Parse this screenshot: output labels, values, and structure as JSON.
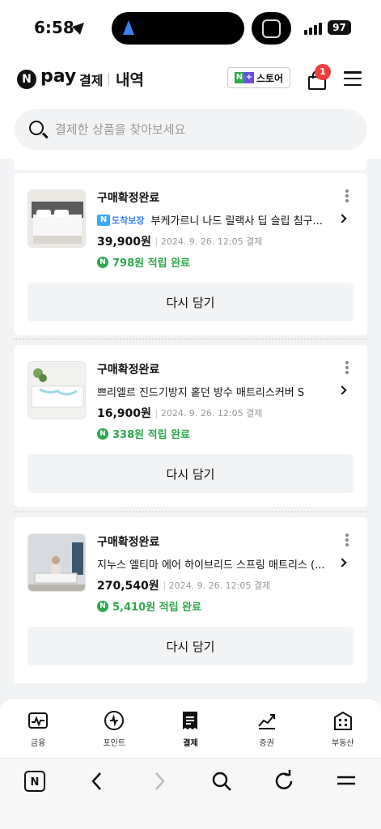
{
  "status_bar": {
    "time": "6:58",
    "battery": "97"
  },
  "header": {
    "logo_n": "N",
    "logo_pay": "pay",
    "logo_sub": "결제",
    "title": "내역",
    "store_label": "스토어",
    "store_badge_n": "N",
    "store_badge_plus": "+",
    "cart_count": "1"
  },
  "search": {
    "placeholder": "결제한 상품을 찾아보세요"
  },
  "orders": [
    {
      "status": "구매확정완료",
      "badge": "도착보장",
      "badge_n": "N",
      "name": "부케가르니 나드 릴랙사 딥 슬립 침구...",
      "price": "39,900원",
      "date": "2024. 9. 26. 12:05 결제",
      "reward": "798원 적립 완료",
      "reward_icon": "N",
      "button": "다시 담기"
    },
    {
      "status": "구매확정완료",
      "name": "쁘리엘르 진드기방지 홑던 방수 매트리스커버 S",
      "price": "16,900원",
      "date": "2024. 9. 26. 12:05 결제",
      "reward": "338원 적립 완료",
      "reward_icon": "N",
      "button": "다시 담기"
    },
    {
      "status": "구매확정완료",
      "name": "지누스 엘티마 에어 하이브리드 스프링 매트리스 (...",
      "price": "270,540원",
      "date": "2024. 9. 26. 12:05 결제",
      "reward": "5,410원 적립 완료",
      "reward_icon": "N",
      "button": "다시 담기"
    }
  ],
  "tabs": [
    {
      "label": "금융",
      "icon": "finance-icon"
    },
    {
      "label": "포인트",
      "icon": "point-icon"
    },
    {
      "label": "결제",
      "icon": "receipt-icon",
      "active": true
    },
    {
      "label": "증권",
      "icon": "chart-icon"
    },
    {
      "label": "부동산",
      "icon": "building-icon"
    }
  ],
  "browser": {
    "home_n": "N"
  },
  "colors": {
    "accent_green": "#2fa84f",
    "badge_red": "#f03e3e",
    "badge_blue": "#3fa9f5"
  }
}
